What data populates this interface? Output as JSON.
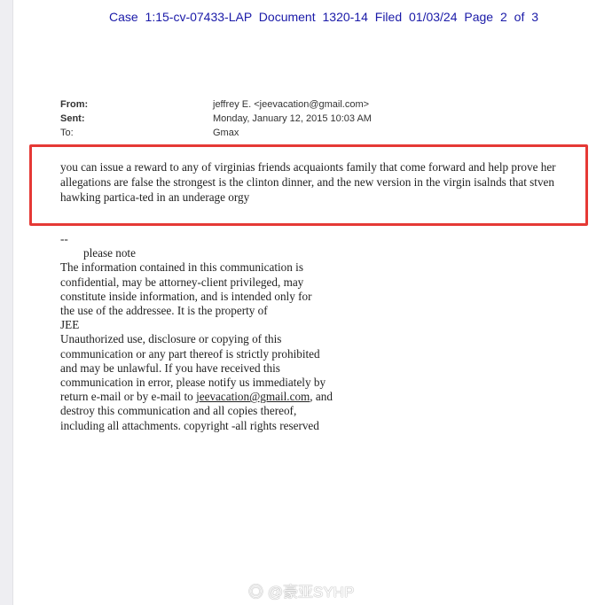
{
  "caption": "Case 1:15-cv-07433-LAP   Document 1320-14   Filed 01/03/24   Page 2 of 3",
  "email": {
    "from_label": "From:",
    "from": "jeffrey E. <jeevacation@gmail.com>",
    "sent_label": "Sent:",
    "sent": "Monday, January 12, 2015 10:03 AM",
    "to_label": "To:",
    "to": "Gmax",
    "body": "you can issue a reward to any of virginias  friends acquaionts  family that come forward  and help prove her allegations are false  the strongest is the clinton dinner,  and the new version in the virgin isalnds  that stven hawking partica-ted in an underage orgy"
  },
  "signature": {
    "dash": "--",
    "note": "please note",
    "lines": [
      "The information contained in this communication is",
      "confidential, may be attorney-client privileged, may",
      "constitute inside information, and is intended only for",
      "the use of the addressee. It is the property of",
      "JEE",
      "Unauthorized use, disclosure or copying of this",
      "communication or any part thereof is strictly prohibited",
      "and may be unlawful. If you have received this",
      "communication in error, please notify us immediately by"
    ],
    "return_prefix": "return e-mail or by e-mail to ",
    "email_link": "jeevacation@gmail.com",
    "return_suffix": ", and",
    "lines2": [
      "destroy this communication and all copies thereof,",
      "including all attachments. copyright -all rights reserved"
    ]
  },
  "watermark": "@豪亚SYHP",
  "highlight_color": "#e53935"
}
